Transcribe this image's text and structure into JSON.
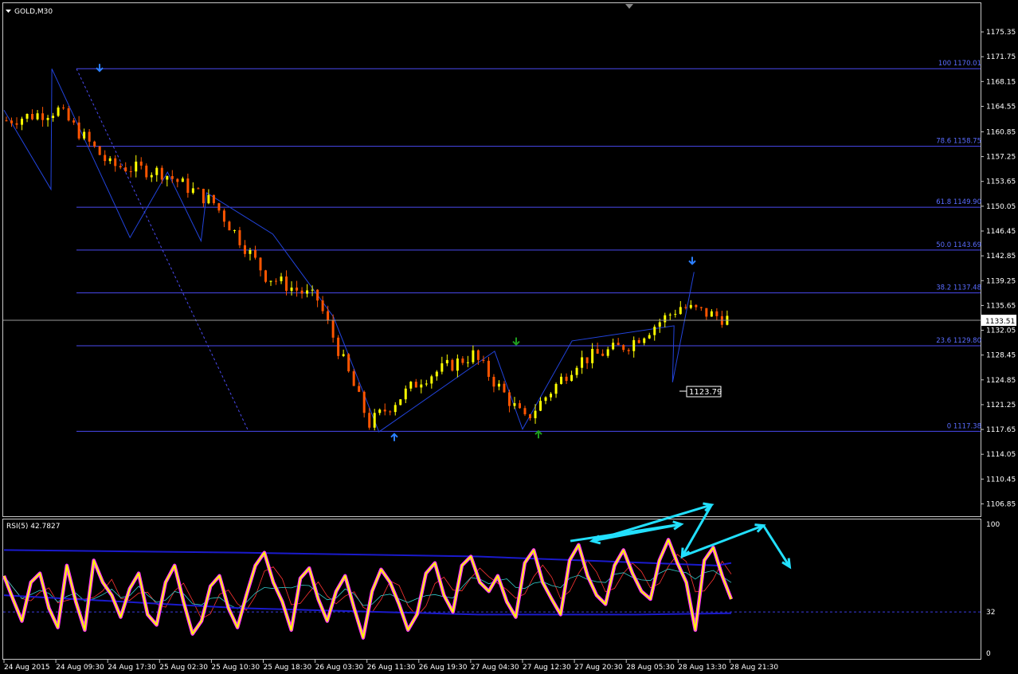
{
  "symbol_label": "GOLD,M30",
  "current_price": "1133.51",
  "low_marker_price": "1123.79",
  "rsi_label": "RSI(5) 42.7827",
  "price_axis": {
    "labels": [
      "1175.35",
      "1171.75",
      "1168.15",
      "1164.55",
      "1160.85",
      "1157.25",
      "1153.65",
      "1150.05",
      "1146.45",
      "1142.85",
      "1139.25",
      "1135.65",
      "1132.05",
      "1128.45",
      "1124.85",
      "1121.25",
      "1117.65",
      "1114.05",
      "1110.45",
      "1106.85"
    ],
    "min": 1105.4,
    "max": 1177.9
  },
  "fib_levels": [
    {
      "label": "100 1170.01",
      "price": 1170.01
    },
    {
      "label": "78.6 1158.75",
      "price": 1158.75
    },
    {
      "label": "61.8 1149.90",
      "price": 1149.9
    },
    {
      "label": "50.0 1143.69",
      "price": 1143.69
    },
    {
      "label": "38.2 1137.48",
      "price": 1137.48
    },
    {
      "label": "23.6 1129.80",
      "price": 1129.8
    },
    {
      "label": "0 1117.38",
      "price": 1117.38
    }
  ],
  "rsi_axis": {
    "labels": [
      "100",
      "32",
      "0"
    ],
    "values": [
      100,
      32,
      0
    ]
  },
  "time_axis": [
    "24 Aug 2015",
    "24 Aug 09:30",
    "24 Aug 17:30",
    "25 Aug 02:30",
    "25 Aug 10:30",
    "25 Aug 18:30",
    "26 Aug 03:30",
    "26 Aug 11:30",
    "26 Aug 19:30",
    "27 Aug 04:30",
    "27 Aug 12:30",
    "27 Aug 20:30",
    "28 Aug 05:30",
    "28 Aug 13:30",
    "28 Aug 21:30"
  ],
  "chart_data": {
    "type": "line",
    "title": "GOLD,M30",
    "x": [
      "24 Aug 2015",
      "24 Aug 09:30",
      "24 Aug 17:30",
      "25 Aug 02:30",
      "25 Aug 10:30",
      "25 Aug 18:30",
      "26 Aug 03:30",
      "26 Aug 11:30",
      "26 Aug 19:30",
      "27 Aug 04:30",
      "27 Aug 12:30",
      "27 Aug 20:30",
      "28 Aug 05:30",
      "28 Aug 13:30",
      "28 Aug 21:30"
    ],
    "ylim": [
      1105.4,
      1177.9
    ],
    "series": [
      {
        "name": "GOLD,M30",
        "values": [
          1162.5,
          1164.0,
          1156.0,
          1155.0,
          1150.5,
          1140.0,
          1136.5,
          1118.5,
          1125.0,
          1128.5,
          1119.0,
          1127.5,
          1130.0,
          1135.5,
          1133.5
        ]
      }
    ],
    "zigzag": [
      {
        "time": "24 Aug 2015",
        "price": 1164.0
      },
      {
        "time": "24 Aug 2015",
        "price": 1152.5
      },
      {
        "time": "24 Aug 09:30",
        "price": 1170.0
      },
      {
        "time": "24 Aug 17:30",
        "price": 1145.5
      },
      {
        "time": "25 Aug 02:30",
        "price": 1155.0
      },
      {
        "time": "25 Aug 10:30",
        "price": 1145.0
      },
      {
        "time": "25 Aug 10:30",
        "price": 1152.0
      },
      {
        "time": "25 Aug 18:30",
        "price": 1146.0
      },
      {
        "time": "26 Aug 03:30",
        "price": 1134.0
      },
      {
        "time": "26 Aug 11:30",
        "price": 1117.3
      },
      {
        "time": "27 Aug 04:30",
        "price": 1129.0
      },
      {
        "time": "27 Aug 12:30",
        "price": 1117.7
      },
      {
        "time": "27 Aug 20:30",
        "price": 1130.5
      },
      {
        "time": "28 Aug 05:30",
        "price": 1132.7
      },
      {
        "time": "28 Aug 13:30",
        "price": 1124.5
      },
      {
        "time": "28 Aug 13:30",
        "price": 1140.5
      }
    ],
    "rsi": {
      "name": "RSI(5)",
      "last": 42.7827,
      "level": 32,
      "ylim": [
        0,
        100
      ],
      "values": [
        60,
        42,
        25,
        55,
        62,
        35,
        20,
        68,
        40,
        18,
        72,
        55,
        45,
        28,
        50,
        62,
        30,
        22,
        55,
        68,
        40,
        15,
        25,
        52,
        60,
        35,
        20,
        45,
        68,
        78,
        55,
        40,
        18,
        58,
        66,
        42,
        25,
        48,
        60,
        35,
        12,
        48,
        65,
        55,
        38,
        18,
        30,
        62,
        70,
        45,
        32,
        68,
        75,
        55,
        48,
        60,
        40,
        28,
        70,
        80,
        55,
        42,
        30,
        72,
        84,
        60,
        45,
        38,
        68,
        80,
        62,
        48,
        42,
        72,
        88,
        70,
        55,
        18,
        72,
        82,
        60,
        42
      ],
      "annotation_zigzag": [
        {
          "time": "27 Aug 20:30",
          "rsi": 87
        },
        {
          "time": "28 Aug 05:30",
          "rsi": 100
        },
        {
          "time": "28 Aug 05:30",
          "rsi": 87
        },
        {
          "time": "28 Aug 13:30",
          "rsi": 115
        },
        {
          "time": "28 Aug 13:30",
          "rsi": 75
        },
        {
          "time": "28 Aug 21:30",
          "rsi": 99
        },
        {
          "time": "28 Aug 21:30",
          "rsi": 67
        }
      ]
    }
  },
  "colors": {
    "background": "#000000",
    "grid_line": "#4a4af0",
    "fib_text": "#5a6cff",
    "candle_bull": "#ffff00",
    "candle_bear": "#ff5500",
    "zigzag": "#2244dd",
    "arrow_blue": "#2c7fff",
    "arrow_green": "#1e9e1e",
    "rsi_main": "#ffff00",
    "rsi_glow": "#ff33ff",
    "annotation": "#22e0ff"
  }
}
